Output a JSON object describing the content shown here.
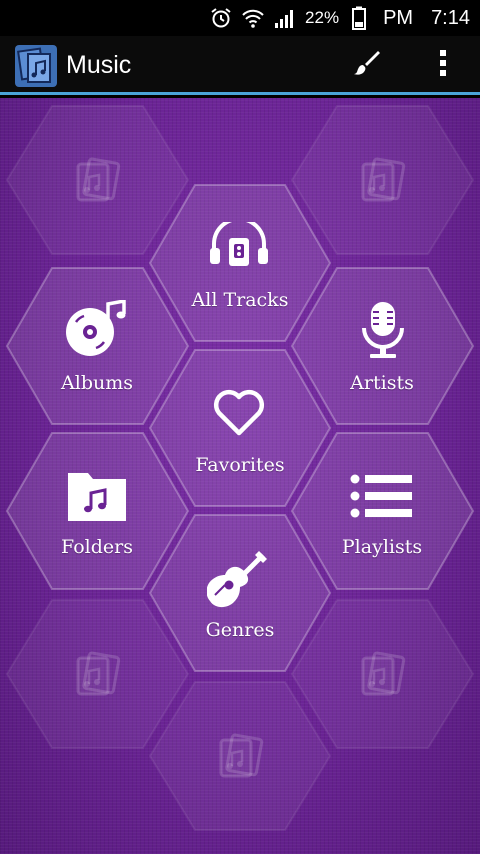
{
  "status_bar": {
    "battery_percent": "22%",
    "ampm": "PM",
    "time": "7:14",
    "icons": [
      "alarm-icon",
      "wifi-icon",
      "signal-icon",
      "battery-icon"
    ]
  },
  "action_bar": {
    "title": "Music",
    "app_icon": "music-app-icon",
    "actions": [
      "brush-icon",
      "overflow-menu-icon"
    ]
  },
  "menu": {
    "all_tracks": "All Tracks",
    "albums": "Albums",
    "artists": "Artists",
    "favorites": "Favorites",
    "folders": "Folders",
    "playlists": "Playlists",
    "genres": "Genres"
  },
  "colors": {
    "background": "#6a2394",
    "accent_line": "#4aa3d8"
  }
}
